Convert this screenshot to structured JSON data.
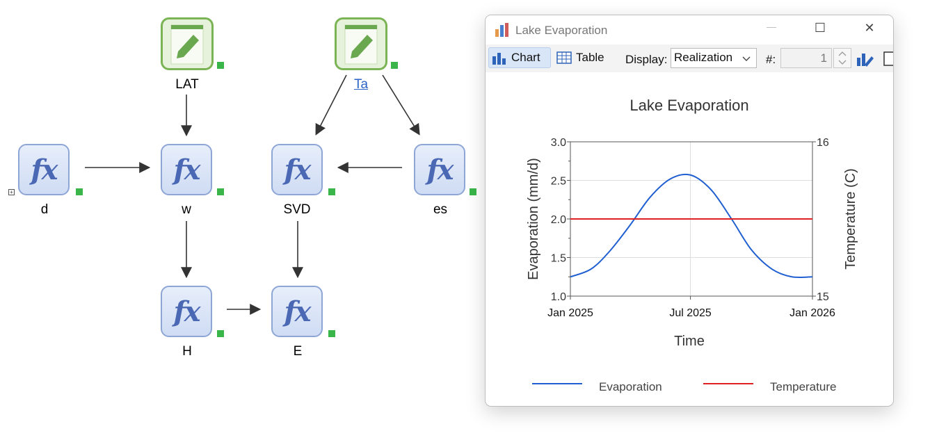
{
  "model": {
    "nodes": [
      {
        "id": "LAT",
        "label": "LAT",
        "type": "data",
        "link": false
      },
      {
        "id": "Ta",
        "label": "Ta",
        "type": "data",
        "link": true
      },
      {
        "id": "d",
        "label": "d",
        "type": "function"
      },
      {
        "id": "w",
        "label": "w",
        "type": "function"
      },
      {
        "id": "SVD",
        "label": "SVD",
        "type": "function"
      },
      {
        "id": "es",
        "label": "es",
        "type": "function"
      },
      {
        "id": "H",
        "label": "H",
        "type": "function"
      },
      {
        "id": "E",
        "label": "E",
        "type": "function"
      }
    ],
    "function_glyph": "fx",
    "expand_glyph": "+",
    "edges": [
      [
        "LAT",
        "w"
      ],
      [
        "d",
        "w"
      ],
      [
        "Ta",
        "SVD"
      ],
      [
        "Ta",
        "es"
      ],
      [
        "es",
        "SVD"
      ],
      [
        "w",
        "H"
      ],
      [
        "SVD",
        "E"
      ],
      [
        "H",
        "E"
      ]
    ],
    "colors": {
      "status": "#39b54a",
      "function_border": "#8ea6d6",
      "data_border": "#7bb455",
      "link": "#2b63c8"
    }
  },
  "window": {
    "title": "Lake Evaporation",
    "icon": "chart-app-icon",
    "controls": {
      "minimize": "—",
      "maximize": "☐",
      "close": "✕"
    },
    "toolbar": {
      "chart_label": "Chart",
      "table_label": "Table",
      "display_label": "Display:",
      "display_value": "Realization",
      "number_label": "#:",
      "number_value": "1"
    }
  },
  "chart_data": {
    "type": "line",
    "title": "Lake Evaporation",
    "xlabel": "Time",
    "ylabel": "Evaporation (mm/d)",
    "y2label": "Temperature (C)",
    "x_ticks": [
      "Jan 2025",
      "Jul 2025",
      "Jan 2026"
    ],
    "ylim": [
      1.0,
      3.0
    ],
    "y_ticks": [
      "1.0",
      "1.5",
      "2.0",
      "2.5",
      "3.0"
    ],
    "y2lim": [
      15,
      16
    ],
    "y2_ticks": [
      "15",
      "16"
    ],
    "grid": true,
    "legend": "bottom",
    "x": [
      "2025-01-01",
      "2025-02-01",
      "2025-03-01",
      "2025-04-01",
      "2025-05-01",
      "2025-06-01",
      "2025-07-01",
      "2025-08-01",
      "2025-09-01",
      "2025-10-01",
      "2025-11-01",
      "2025-12-01",
      "2026-01-01"
    ],
    "series": [
      {
        "name": "Evaporation",
        "axis": "left",
        "color": "#1f5fd1",
        "values": [
          1.25,
          1.35,
          1.58,
          1.92,
          2.28,
          2.52,
          2.57,
          2.38,
          2.0,
          1.6,
          1.35,
          1.25,
          1.25
        ]
      },
      {
        "name": "Temperature",
        "axis": "right",
        "color": "#e02020",
        "values": [
          15.5,
          15.5,
          15.5,
          15.5,
          15.5,
          15.5,
          15.5,
          15.5,
          15.5,
          15.5,
          15.5,
          15.5,
          15.5
        ]
      }
    ]
  }
}
